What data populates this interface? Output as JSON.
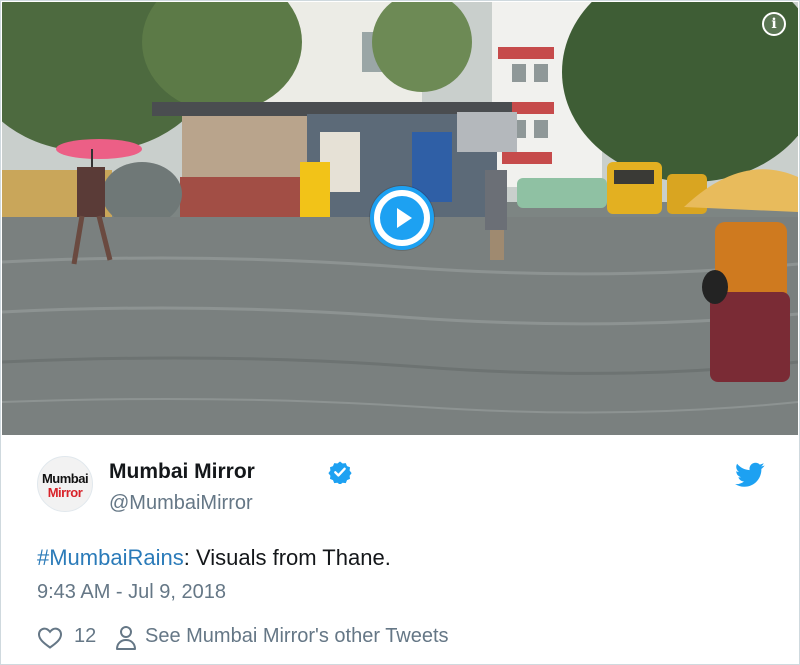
{
  "media": {
    "info_icon": "info-icon",
    "play_icon": "play-icon"
  },
  "author": {
    "avatar_line1": "Mumbai",
    "avatar_line2": "Mirror",
    "display_name": "Mumbai Mirror",
    "handle": "@MumbaiMirror",
    "verified_icon": "verified-badge-icon",
    "platform_icon": "twitter-bird-icon"
  },
  "tweet": {
    "hashtag": "#MumbaiRains",
    "text": ": Visuals from Thane.",
    "timestamp": "9:43 AM - Jul 9, 2018"
  },
  "actions": {
    "like_icon": "heart-icon",
    "like_count": "12",
    "profile_icon": "person-icon",
    "other_tweets_label": "See Mumbai Mirror's other Tweets"
  },
  "colors": {
    "link_blue": "#2b7bb9",
    "twitter_blue": "#1da1f2",
    "secondary_text": "#657786",
    "primary_text": "#14171a"
  }
}
